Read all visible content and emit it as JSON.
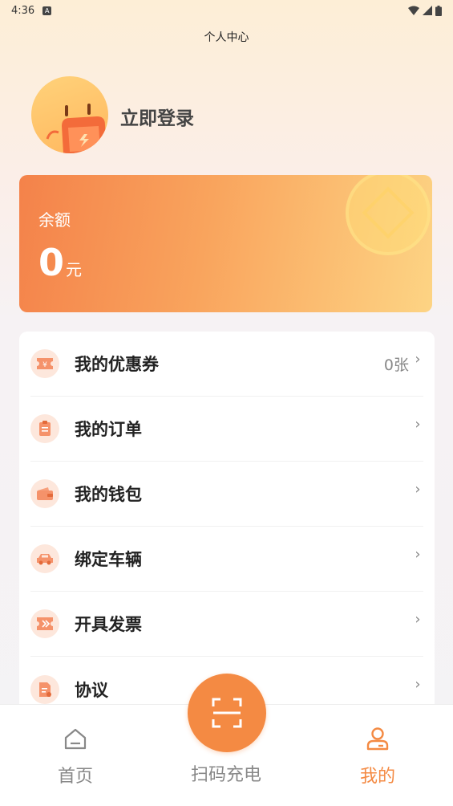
{
  "status": {
    "time": "4:36",
    "notif": "A"
  },
  "header": {
    "title": "个人中心"
  },
  "profile": {
    "login_label": "立即登录"
  },
  "balance": {
    "label": "余额",
    "value": "0",
    "unit": "元"
  },
  "menu": {
    "items": [
      {
        "label": "我的优惠券",
        "value": "0张",
        "icon": "coupon-icon"
      },
      {
        "label": "我的订单",
        "value": "",
        "icon": "order-icon"
      },
      {
        "label": "我的钱包",
        "value": "",
        "icon": "wallet-icon"
      },
      {
        "label": "绑定车辆",
        "value": "",
        "icon": "car-icon"
      },
      {
        "label": "开具发票",
        "value": "",
        "icon": "invoice-icon"
      },
      {
        "label": "协议",
        "value": "",
        "icon": "agreement-icon"
      }
    ]
  },
  "tabbar": {
    "home": "首页",
    "scan": "扫码充电",
    "me": "我的"
  },
  "colors": {
    "accent": "#f48a43",
    "accent_light": "#fde7dc"
  }
}
